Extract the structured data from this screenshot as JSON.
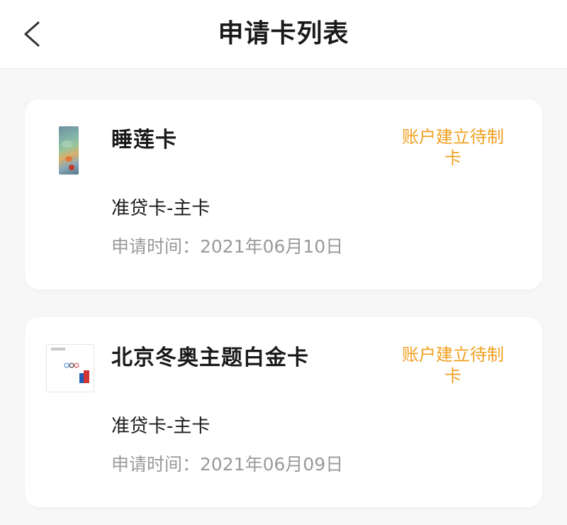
{
  "header": {
    "title": "申请卡列表",
    "back_icon": "chevron-left-icon"
  },
  "colors": {
    "status": "#f0a020",
    "muted": "#9a9a9a",
    "background": "#f7f7f7"
  },
  "cards": [
    {
      "name": "睡莲卡",
      "status": "账户建立待制卡",
      "type": "准贷卡-主卡",
      "apply_time": "申请时间：2021年06月10日",
      "thumbnail": "water-lily-card-image"
    },
    {
      "name": "北京冬奥主题白金卡",
      "status": "账户建立待制卡",
      "type": "准贷卡-主卡",
      "apply_time": "申请时间：2021年06月09日",
      "thumbnail": "beijing-winter-olympics-card-image"
    }
  ]
}
